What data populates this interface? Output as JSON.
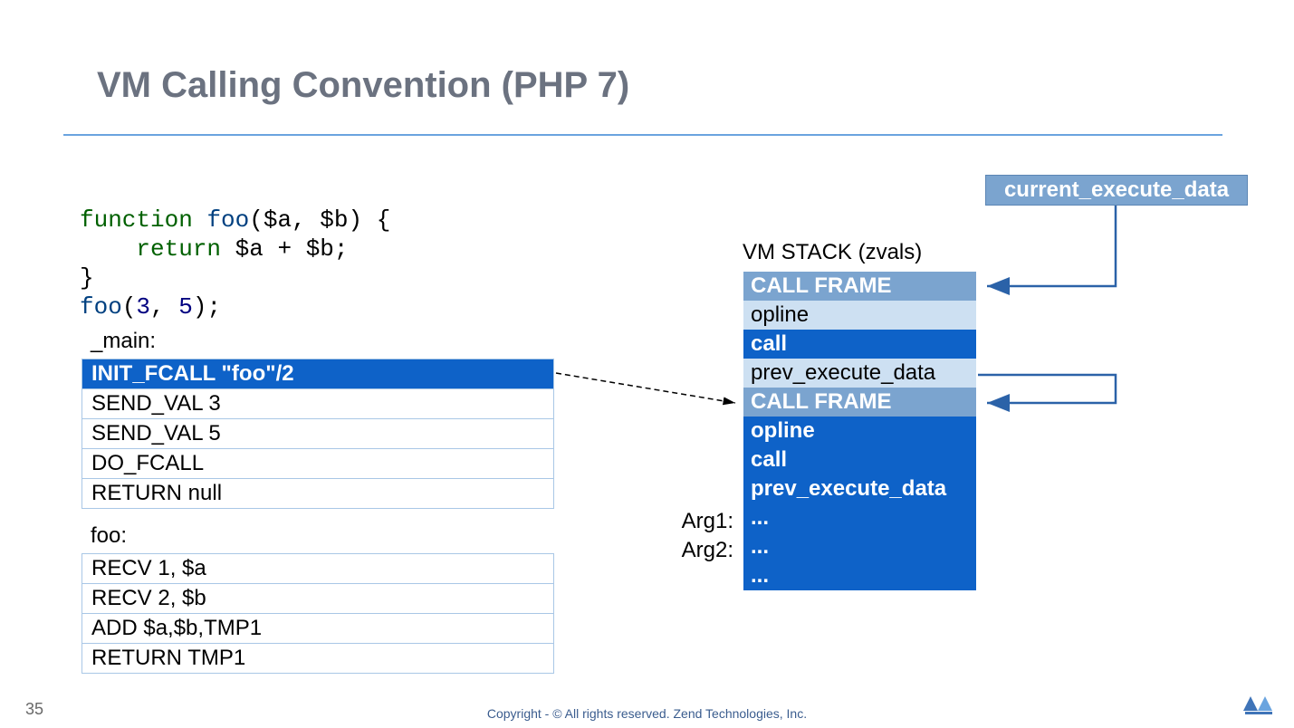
{
  "title": "VM Calling Convention (PHP 7)",
  "page_number": "35",
  "footer": "Copyright - © All rights reserved. Zend Technologies, Inc.",
  "code": {
    "line1": {
      "kw": "function",
      "space": " ",
      "fn": "foo",
      "open": "(",
      "a": "$a",
      "comma": ", ",
      "b": "$b",
      "close": ") {"
    },
    "line2": {
      "indent": "    ",
      "ret": "return",
      "sp": " ",
      "a": "$a",
      "plus": " + ",
      "b": "$b",
      "semi": ";"
    },
    "line3": "}",
    "line4": {
      "fn": "foo",
      "open": "(",
      "n1": "3",
      "comma": ", ",
      "n2": "5",
      "close": ");"
    }
  },
  "main_table": {
    "label": "_main:",
    "rows": [
      "INIT_FCALL  \"foo\"/2",
      "SEND_VAL 3",
      "SEND_VAL 5",
      "DO_FCALL",
      "RETURN null"
    ],
    "highlight_index": 0
  },
  "foo_table": {
    "label": "foo:",
    "rows": [
      "RECV 1, $a",
      "RECV 2, $b",
      "ADD $a,$b,TMP1",
      "RETURN TMP1"
    ]
  },
  "stack_title": "VM STACK (zvals)",
  "stack_rows": [
    {
      "text": "CALL FRAME",
      "class": "row-header-muted"
    },
    {
      "text": "opline",
      "class": "row-light"
    },
    {
      "text": "call",
      "class": "row-dark"
    },
    {
      "text": "prev_execute_data",
      "class": "row-light"
    },
    {
      "text": "CALL FRAME",
      "class": "row-header-muted"
    },
    {
      "text": "opline",
      "class": "row-dark"
    },
    {
      "text": "call",
      "class": "row-dark"
    },
    {
      "text": "prev_execute_data",
      "class": "row-dark"
    },
    {
      "text": "...",
      "class": "row-dark"
    },
    {
      "text": "...",
      "class": "row-dark"
    },
    {
      "text": "...",
      "class": "row-dark"
    }
  ],
  "arg_labels": {
    "a1": "Arg1:",
    "a2": "Arg2:"
  },
  "exec_box": "current_execute_data",
  "colors": {
    "blue": "#0e62c8",
    "muted_blue": "#7ba4cf",
    "light_blue": "#cde0f2",
    "rule": "#6aa4df"
  }
}
